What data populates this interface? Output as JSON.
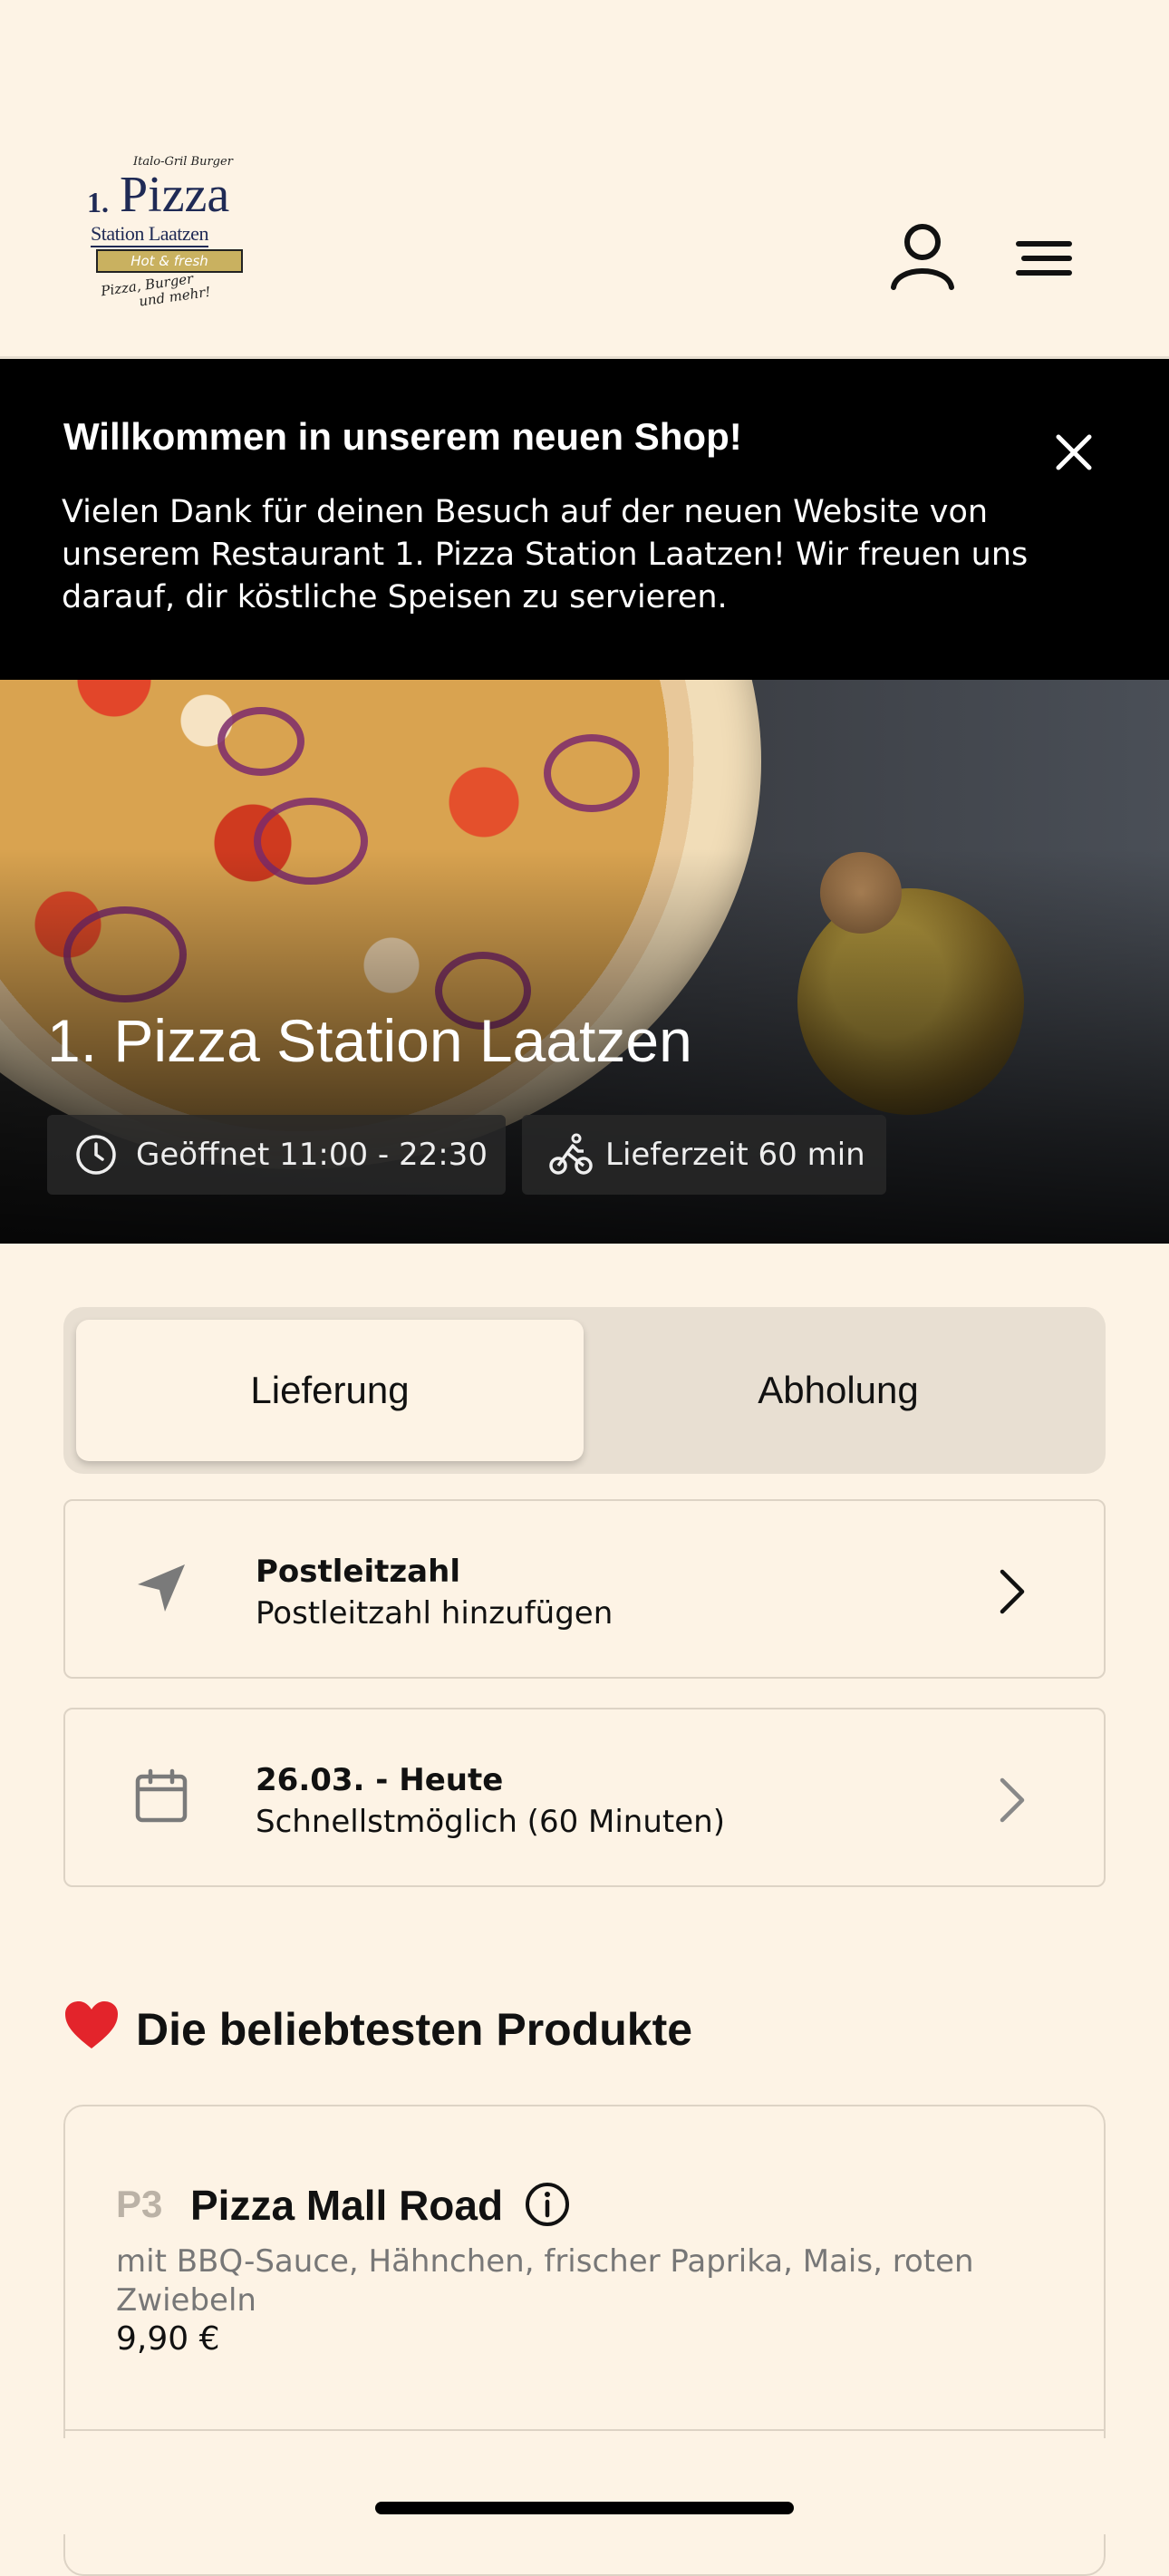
{
  "header": {
    "logo": {
      "small_text": "Italo-Gril Burger",
      "number": "1.",
      "name": "Pizza",
      "station": "Station Laatzen",
      "ribbon": "Hot & fresh",
      "tagline_1": "Pizza, Burger",
      "tagline_2": "und mehr!"
    },
    "user_icon": "user-icon",
    "menu_icon": "menu-icon"
  },
  "banner": {
    "title": "Willkommen in unserem neuen Shop!",
    "text": "Vielen Dank für deinen Besuch auf der neuen Website von unserem Restaurant 1. Pizza Station Laatzen! Wir freuen uns darauf, dir köstliche Speisen zu servieren.",
    "close_icon": "close-icon"
  },
  "hero": {
    "title": "1. Pizza Station Laatzen",
    "opening": "Geöffnet 11:00 - 22:30",
    "delivery_time": "Lieferzeit 60 min"
  },
  "order_mode": {
    "options": [
      "Lieferung",
      "Abholung"
    ],
    "selected": "Lieferung"
  },
  "zip_card": {
    "title": "Postleitzahl",
    "subtitle": "Postleitzahl hinzufügen"
  },
  "date_card": {
    "title": "26.03. - Heute",
    "subtitle": "Schnellstmöglich (60 Minuten)"
  },
  "popular": {
    "title": "Die beliebtesten Produkte",
    "products": [
      {
        "code": "P3",
        "name": "Pizza Mall Road",
        "description": "mit BBQ-Sauce, Hähnchen, frischer Paprika, Mais, roten Zwiebeln",
        "price": "9,90 €"
      }
    ]
  },
  "colors": {
    "background": "#fdf3e5",
    "banner": "#000000",
    "toggle_bg": "#e8dfd2",
    "border": "#ddd3c5",
    "heart": "#e3242b"
  }
}
